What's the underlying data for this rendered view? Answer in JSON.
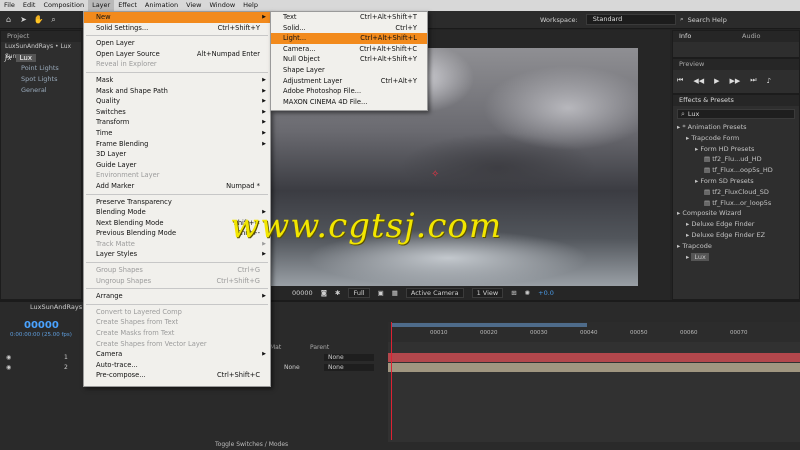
{
  "menubar": [
    "File",
    "Edit",
    "Composition",
    "Layer",
    "Effect",
    "Animation",
    "View",
    "Window",
    "Help"
  ],
  "menubar_active": "Layer",
  "workspace": {
    "label": "Workspace:",
    "value": "Standard"
  },
  "search_help": "Search Help",
  "project_tab": "Project",
  "effect_controls": {
    "header": "LuxSunAndRays • Lux Sun",
    "fx_name": "Lux",
    "items": [
      "Point Lights",
      "Spot Lights",
      "General"
    ]
  },
  "info_tabs": [
    "Info",
    "Audio"
  ],
  "preview_tab": "Preview",
  "effects_presets": {
    "tab": "Effects & Presets",
    "search": "Lux",
    "tree": [
      {
        "label": "* Animation Presets",
        "indent": 0
      },
      {
        "label": "Trapcode Form",
        "indent": 1
      },
      {
        "label": "Form HD Presets",
        "indent": 2
      },
      {
        "label": "tf2_Flu...ud_HD",
        "indent": 3
      },
      {
        "label": "tf_Flux...oop5s_HD",
        "indent": 3
      },
      {
        "label": "Form SD Presets",
        "indent": 2
      },
      {
        "label": "tf2_FluxCloud_SD",
        "indent": 3
      },
      {
        "label": "tf_Flux...or_loop5s",
        "indent": 3
      },
      {
        "label": "Composite Wizard",
        "indent": 0
      },
      {
        "label": "Deluxe Edge Finder",
        "indent": 1
      },
      {
        "label": "Deluxe Edge Finder EZ",
        "indent": 1
      },
      {
        "label": "Trapcode",
        "indent": 0
      },
      {
        "label": "Lux",
        "indent": 1
      }
    ]
  },
  "viewer_bar": {
    "timecode": "00000",
    "resolution": "Full",
    "camera": "Active Camera",
    "views": "1 View",
    "exposure": "+0.0"
  },
  "layer_menu": [
    {
      "label": "New",
      "arrow": true,
      "hl": true
    },
    {
      "label": "Solid Settings...",
      "sc": "Ctrl+Shift+Y"
    },
    {
      "sep": true
    },
    {
      "label": "Open Layer"
    },
    {
      "label": "Open Layer Source",
      "sc": "Alt+Numpad Enter"
    },
    {
      "label": "Reveal in Explorer",
      "dis": true
    },
    {
      "sep": true
    },
    {
      "label": "Mask",
      "arrow": true
    },
    {
      "label": "Mask and Shape Path",
      "arrow": true
    },
    {
      "label": "Quality",
      "arrow": true
    },
    {
      "label": "Switches",
      "arrow": true
    },
    {
      "label": "Transform",
      "arrow": true
    },
    {
      "label": "Time",
      "arrow": true
    },
    {
      "label": "Frame Blending",
      "arrow": true
    },
    {
      "label": "3D Layer"
    },
    {
      "label": "Guide Layer"
    },
    {
      "label": "Environment Layer",
      "dis": true
    },
    {
      "label": "Add Marker",
      "sc": "Numpad *"
    },
    {
      "sep": true
    },
    {
      "label": "Preserve Transparency"
    },
    {
      "label": "Blending Mode",
      "arrow": true
    },
    {
      "label": "Next Blending Mode",
      "sc": "Shift+="
    },
    {
      "label": "Previous Blending Mode",
      "sc": "Shift+-"
    },
    {
      "label": "Track Matte",
      "arrow": true,
      "dis": true
    },
    {
      "label": "Layer Styles",
      "arrow": true
    },
    {
      "sep": true
    },
    {
      "label": "Group Shapes",
      "sc": "Ctrl+G",
      "dis": true
    },
    {
      "label": "Ungroup Shapes",
      "sc": "Ctrl+Shift+G",
      "dis": true
    },
    {
      "sep": true
    },
    {
      "label": "Arrange",
      "arrow": true
    },
    {
      "sep": true
    },
    {
      "label": "Convert to Layered Comp",
      "dis": true
    },
    {
      "label": "Create Shapes from Text",
      "dis": true
    },
    {
      "label": "Create Masks from Text",
      "dis": true
    },
    {
      "label": "Create Shapes from Vector Layer",
      "dis": true
    },
    {
      "label": "Camera",
      "arrow": true
    },
    {
      "label": "Auto-trace..."
    },
    {
      "label": "Pre-compose...",
      "sc": "Ctrl+Shift+C"
    }
  ],
  "new_menu": [
    {
      "label": "Text",
      "sc": "Ctrl+Alt+Shift+T"
    },
    {
      "label": "Solid...",
      "sc": "Ctrl+Y"
    },
    {
      "label": "Light...",
      "sc": "Ctrl+Alt+Shift+L",
      "hl": true
    },
    {
      "label": "Camera...",
      "sc": "Ctrl+Alt+Shift+C"
    },
    {
      "label": "Null Object",
      "sc": "Ctrl+Alt+Shift+Y"
    },
    {
      "label": "Shape Layer"
    },
    {
      "label": "Adjustment Layer",
      "sc": "Ctrl+Alt+Y"
    },
    {
      "label": "Adobe Photoshop File..."
    },
    {
      "label": "MAXON CINEMA 4D File..."
    }
  ],
  "timeline": {
    "comp_name": "LuxSunAndRays",
    "timecode": "00000",
    "timecode_sub": "0:00:00:00 (25.00 fps)",
    "ruler_ticks": [
      "00010",
      "00020",
      "00030",
      "00040",
      "00050",
      "00060",
      "00070"
    ],
    "col_mat": "Mat",
    "col_parent": "Parent",
    "rows": [
      {
        "num": "1",
        "mat": "",
        "parent": "None"
      },
      {
        "num": "2",
        "mat": "None",
        "parent": "None"
      }
    ],
    "toggle_label": "Toggle Switches / Modes"
  },
  "watermark": "www.cgtsj.com"
}
